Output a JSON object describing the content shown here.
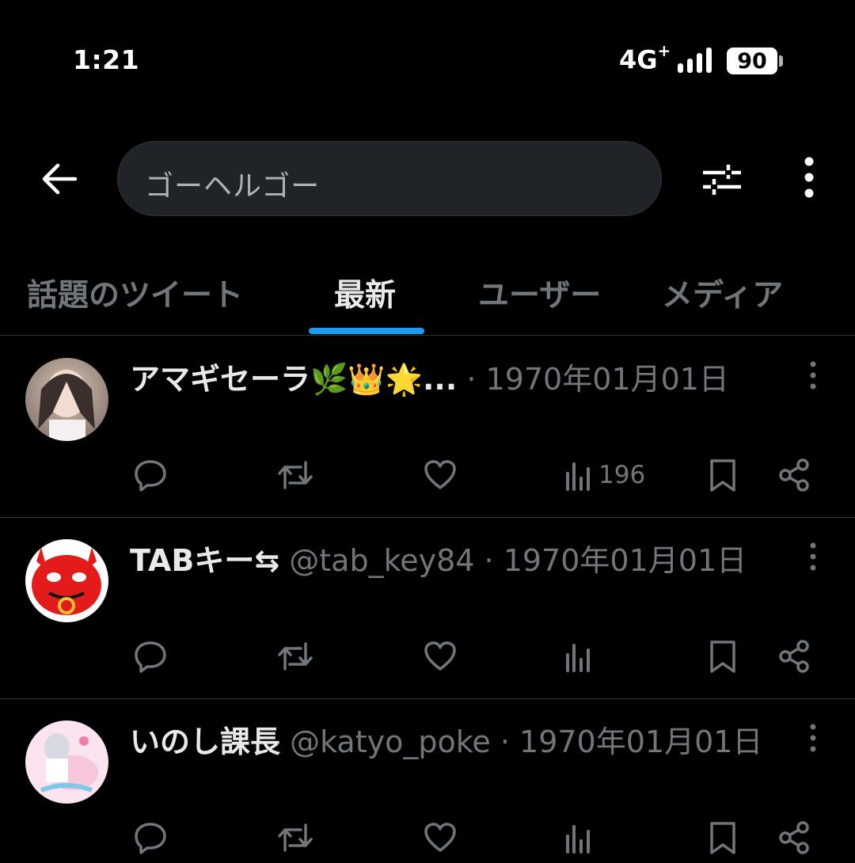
{
  "status_bar": {
    "time": "1:21",
    "network": "4G",
    "network_plus": "+",
    "battery": "90"
  },
  "header": {
    "search_query": "ゴーヘルゴー",
    "back_icon": "arrow-left-icon",
    "filter_icon": "sliders-icon",
    "more_icon": "kebab-icon"
  },
  "tabs": [
    {
      "label": "話題のツイート",
      "active": false
    },
    {
      "label": "最新",
      "active": true
    },
    {
      "label": "ユーザー",
      "active": false
    },
    {
      "label": "メディア",
      "active": false
    }
  ],
  "colors": {
    "background": "#000000",
    "accent": "#1d9bf0",
    "text_primary": "#e7e9ea",
    "text_secondary": "#71767b",
    "divider": "#2f3336"
  },
  "tweets": [
    {
      "name": "アマギセーラ🌿👑🌟...",
      "handle": "",
      "separator": " · ",
      "date": "1970年01月01日",
      "views": "196"
    },
    {
      "name": "TABキー⇆",
      "handle": " @tab_key84",
      "separator": " · ",
      "date": "1970年01月01日",
      "views": ""
    },
    {
      "name": "いのし課長",
      "handle": " @katyo_poke",
      "separator": " · ",
      "date": "1970年01月01日",
      "views": ""
    }
  ]
}
